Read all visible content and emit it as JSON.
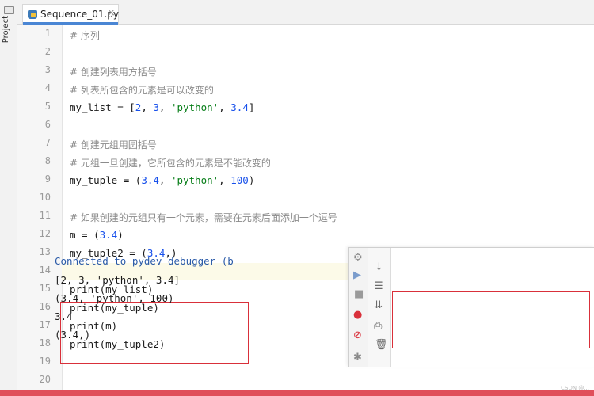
{
  "sidebar": {
    "label": "Project"
  },
  "tab": {
    "filename": "Sequence_01.py",
    "close_glyph": "×"
  },
  "editor": {
    "line_numbers": [
      "1",
      "2",
      "3",
      "4",
      "5",
      "6",
      "7",
      "8",
      "9",
      "10",
      "11",
      "12",
      "13",
      "14",
      "15",
      "16",
      "17",
      "18",
      "19",
      "20"
    ],
    "lines": [
      {
        "text": "# 序列"
      },
      {
        "text": ""
      },
      {
        "text": "# 创建列表用方括号"
      },
      {
        "text": "# 列表所包含的元素是可以改变的"
      },
      {
        "pre": "my_list = [",
        "n1": "2",
        "s1": ", ",
        "n2": "3",
        "s2": ", ",
        "str": "'python'",
        "s3": ", ",
        "n3": "3.4",
        "post": "]"
      },
      {
        "text": ""
      },
      {
        "text": "# 创建元组用圆括号"
      },
      {
        "text": "# 元组一旦创建，它所包含的元素是不能改变的"
      },
      {
        "pre": "my_tuple = (",
        "n1": "3.4",
        "s1": ", ",
        "str": "'python'",
        "s2": ", ",
        "n2": "100",
        "post": ")"
      },
      {
        "text": ""
      },
      {
        "text": "# 如果创建的元组只有一个元素，需要在元素后面添加一个逗号"
      },
      {
        "pre": "m = (",
        "n1": "3.4",
        "post": ")"
      },
      {
        "pre": "my_tuple2 = (",
        "n1": "3.4",
        "post": ",)"
      },
      {
        "text": ""
      },
      {
        "text": "print(my_list)"
      },
      {
        "text": "print(my_tuple)"
      },
      {
        "text": "print(m)"
      },
      {
        "text": "print(my_tuple2)"
      },
      {
        "text": ""
      },
      {
        "text": ""
      }
    ]
  },
  "console": {
    "output": [
      "Connected to pydev debugger (b",
      "[2, 3, 'python', 3.4]",
      "(3.4, 'python', 100)",
      "3.4",
      "(3.4,)"
    ],
    "tool_icons": [
      "down-arrow-icon",
      "rerun-icon",
      "stop-icon",
      "wrap-icon",
      "scroll-end-icon",
      "debug-icon",
      "mute-breakpoints-icon",
      "print-icon",
      "trash-icon",
      "settings-icon"
    ]
  },
  "colors": {
    "accent": "#4a86d4",
    "highlight_box": "#d9303a",
    "comment": "#8a8a8a",
    "number": "#1750eb",
    "string": "#067d17",
    "console_header": "#2a5aa8"
  },
  "watermark": "CSDN @..."
}
